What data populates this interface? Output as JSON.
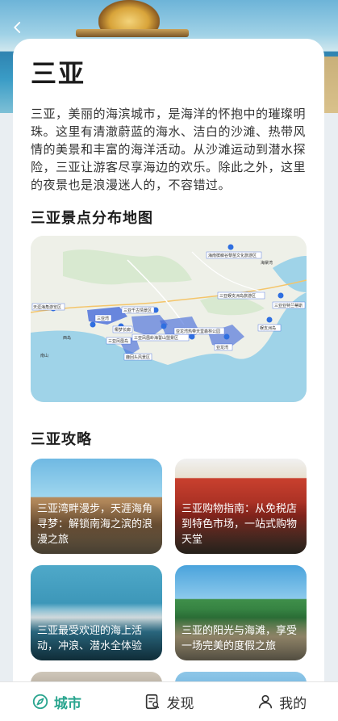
{
  "city": {
    "title": "三亚",
    "intro": "三亚，美丽的海滨城市，是海洋的怀抱中的璀璨明珠。这里有清澈蔚蓝的海水、洁白的沙滩、热带风情的美景和丰富的海洋活动。从沙滩运动到潜水探险，三亚让游客尽享海边的欢乐。除此之外，这里的夜景也是浪漫迷人的，不容错过。"
  },
  "map_section": {
    "title": "三亚景点分布地图",
    "labels": [
      "海南槟榔谷黎苗文化旅游区",
      "天涯海角游览区",
      "三亚千古情景区",
      "三亚湾",
      "椰梦长廊",
      "三亚凤凰岛",
      "鹿回头风景区",
      "三亚凤凰岭海誓山盟景区",
      "亚龙湾热带天堂森林公园",
      "三亚蜈支洲岛旅游区",
      "亚龙湾",
      "三亚亚特兰蒂斯",
      "蜈支洲岛",
      "南山",
      "西岛",
      "海棠湾"
    ]
  },
  "guides_section": {
    "title": "三亚攻略",
    "items": [
      {
        "caption": "三亚湾畔漫步，天涯海角寻梦：解锁南海之滨的浪漫之旅"
      },
      {
        "caption": "三亚购物指南：从免税店到特色市场，一站式购物天堂"
      },
      {
        "caption": "三亚最受欢迎的海上活动，冲浪、潜水全体验"
      },
      {
        "caption": "三亚的阳光与海滩，享受一场完美的度假之旅"
      }
    ]
  },
  "nav": {
    "items": [
      {
        "label": "城市",
        "icon": "compass-icon",
        "active": true
      },
      {
        "label": "发现",
        "icon": "discover-icon",
        "active": false
      },
      {
        "label": "我的",
        "icon": "user-icon",
        "active": false
      }
    ]
  },
  "colors": {
    "accent": "#2aa58f",
    "sea": "#9fd3e8"
  }
}
